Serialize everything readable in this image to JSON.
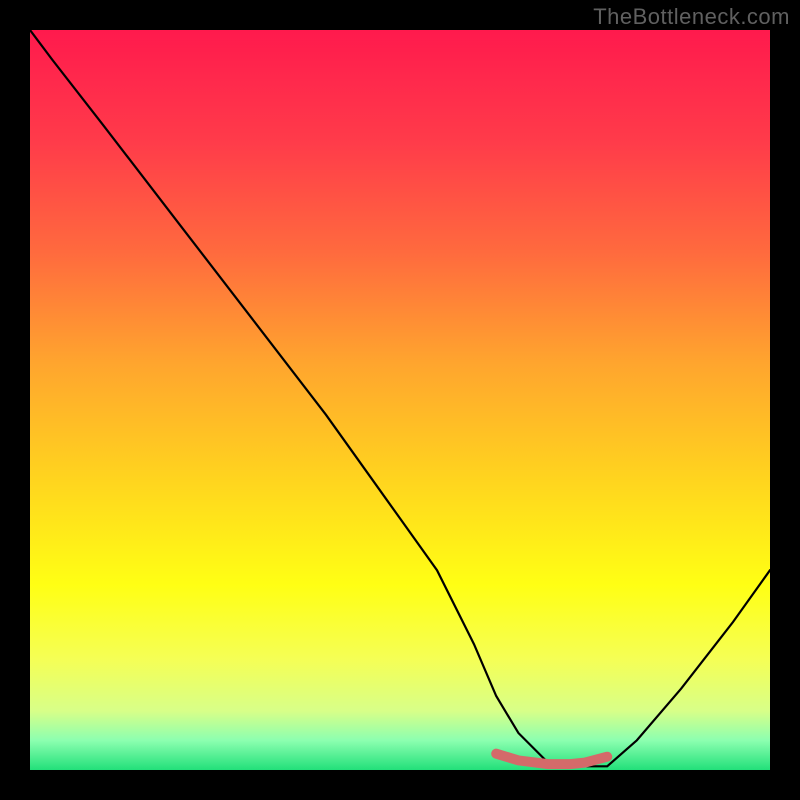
{
  "watermark": "TheBottleneck.com",
  "colors": {
    "background": "#000000",
    "curve": "#000000",
    "highlight": "#d46a6a",
    "gradient_stops": [
      {
        "offset": 0.0,
        "color": "#ff1a4d"
      },
      {
        "offset": 0.15,
        "color": "#ff3b4a"
      },
      {
        "offset": 0.3,
        "color": "#ff6a3e"
      },
      {
        "offset": 0.45,
        "color": "#ffa52e"
      },
      {
        "offset": 0.6,
        "color": "#ffd21f"
      },
      {
        "offset": 0.75,
        "color": "#ffff14"
      },
      {
        "offset": 0.85,
        "color": "#f5ff55"
      },
      {
        "offset": 0.92,
        "color": "#d8ff88"
      },
      {
        "offset": 0.96,
        "color": "#8cffb0"
      },
      {
        "offset": 1.0,
        "color": "#22e07a"
      }
    ]
  },
  "chart_data": {
    "type": "line",
    "title": "",
    "xlabel": "",
    "ylabel": "",
    "xlim": [
      0,
      100
    ],
    "ylim": [
      0,
      100
    ],
    "series": [
      {
        "name": "bottleneck-curve",
        "x": [
          0,
          3,
          10,
          20,
          30,
          40,
          50,
          55,
          60,
          63,
          66,
          70,
          73,
          75,
          78,
          82,
          88,
          95,
          100
        ],
        "y": [
          100,
          96,
          87,
          74,
          61,
          48,
          34,
          27,
          17,
          10,
          5,
          1,
          0.5,
          0.5,
          0.5,
          4,
          11,
          20,
          27
        ]
      }
    ],
    "highlight_segment": {
      "name": "optimal-region",
      "x": [
        63,
        66,
        70,
        73,
        75,
        78
      ],
      "y": [
        2.2,
        1.3,
        0.8,
        0.8,
        1.0,
        1.8
      ]
    }
  }
}
